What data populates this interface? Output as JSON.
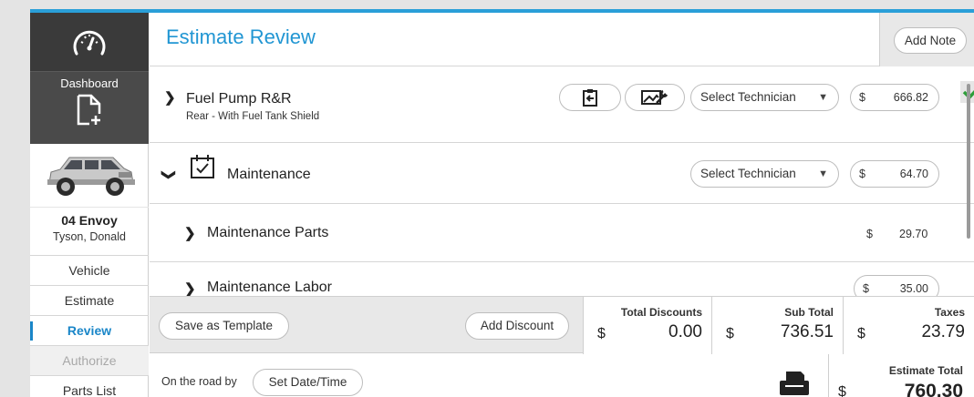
{
  "sidebar": {
    "dashboard_label": "Dashboard",
    "vehicle_name": "04 Envoy",
    "customer_name": "Tyson, Donald",
    "nav": [
      {
        "label": "Vehicle"
      },
      {
        "label": "Estimate"
      },
      {
        "label": "Review"
      },
      {
        "label": "Authorize"
      },
      {
        "label": "Parts List"
      }
    ]
  },
  "header": {
    "title": "Estimate Review",
    "add_note_label": "Add Note"
  },
  "rows": {
    "fuel_pump": {
      "title": "Fuel Pump R&R",
      "subtitle": "Rear - With Fuel Tank Shield",
      "technician_placeholder": "Select Technician",
      "currency": "$",
      "amount": "666.82"
    },
    "maintenance": {
      "title": "Maintenance",
      "technician_placeholder": "Select Technician",
      "currency": "$",
      "amount": "64.70"
    },
    "maintenance_parts": {
      "title": "Maintenance Parts",
      "currency": "$",
      "amount": "29.70"
    },
    "maintenance_labor": {
      "title": "Maintenance Labor",
      "currency": "$",
      "amount": "35.00"
    }
  },
  "totals": {
    "save_template_label": "Save as Template",
    "add_discount_label": "Add Discount",
    "total_discounts_label": "Total Discounts",
    "total_discounts_value": "0.00",
    "sub_total_label": "Sub Total",
    "sub_total_value": "736.51",
    "taxes_label": "Taxes",
    "taxes_value": "23.79",
    "currency": "$"
  },
  "bottom": {
    "on_the_road_label": "On the road by",
    "set_datetime_label": "Set Date/Time",
    "estimate_total_label": "Estimate Total",
    "estimate_total_value": "760.30",
    "currency": "$"
  },
  "colors": {
    "accent": "#2196d3",
    "top_bar": "#2a9fd8",
    "sidebar_dark": "#3a3a3a",
    "check_green": "#2e9e3a"
  },
  "icons": [
    "gauge-icon",
    "new-document-icon",
    "vehicle-image",
    "transfer-icon",
    "tools-icon",
    "dropdown-arrow-icon",
    "check-icon",
    "calendar-check-icon",
    "printer-icon"
  ]
}
